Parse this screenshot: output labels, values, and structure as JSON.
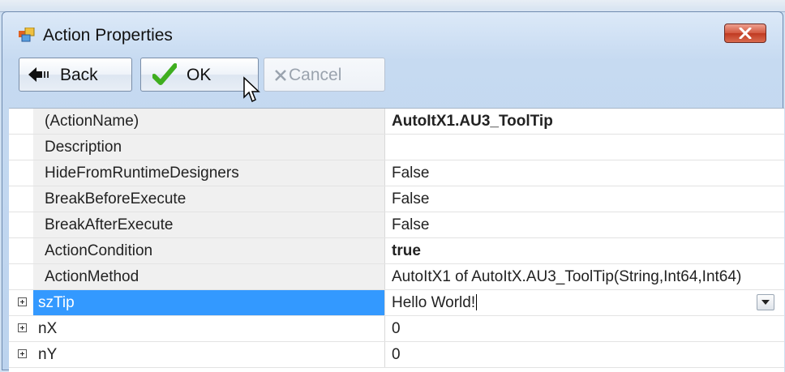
{
  "window": {
    "title": "Action Properties"
  },
  "toolbar": {
    "back_label": "Back",
    "ok_label": "OK",
    "cancel_label": "Cancel"
  },
  "properties": [
    {
      "name": "(ActionName)",
      "value": "AutoItX1.AU3_ToolTip",
      "bold": true
    },
    {
      "name": "Description",
      "value": ""
    },
    {
      "name": "HideFromRuntimeDesigners",
      "value": "False"
    },
    {
      "name": "BreakBeforeExecute",
      "value": "False"
    },
    {
      "name": "BreakAfterExecute",
      "value": "False"
    },
    {
      "name": "ActionCondition",
      "value": "true",
      "bold": true
    },
    {
      "name": "ActionMethod",
      "value": "AutoItX1 of AutoItX.AU3_ToolTip(String,Int64,Int64)"
    },
    {
      "name": "szTip",
      "value": "Hello World!",
      "expandable": true,
      "selected": true,
      "editing": true
    },
    {
      "name": "nX",
      "value": "0",
      "expandable": true
    },
    {
      "name": "nY",
      "value": "0",
      "expandable": true
    }
  ],
  "icons": {
    "app": "app-properties-icon",
    "close": "close-icon",
    "back": "back-arrow-icon",
    "ok": "checkmark-icon",
    "cancel": "x-icon",
    "expander": "expand-plus-icon",
    "dropdown": "chevron-down-icon",
    "cursor": "mouse-pointer-icon"
  },
  "colors": {
    "selection": "#3399ff",
    "ok_check": "#3fae1f",
    "close_button": "#c8462f",
    "grid_name_bg": "#f0f0f0"
  }
}
